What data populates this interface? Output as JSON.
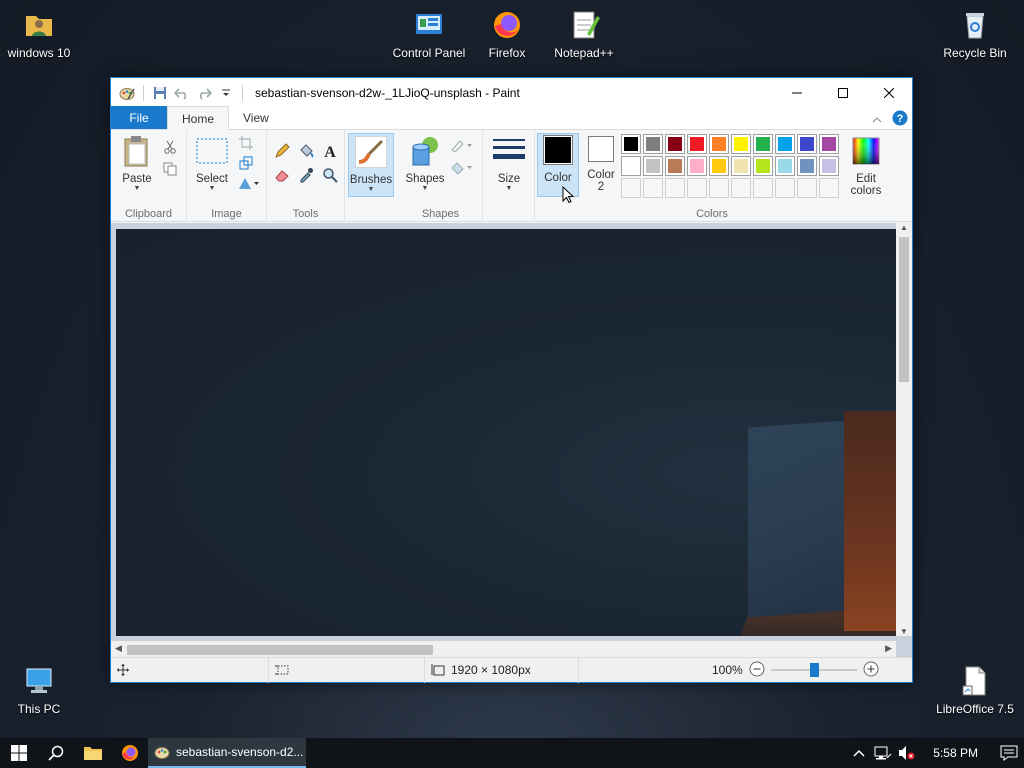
{
  "desktop": {
    "icons": [
      {
        "label": "windows 10"
      },
      {
        "label": "Control Panel"
      },
      {
        "label": "Firefox"
      },
      {
        "label": "Notepad++"
      },
      {
        "label": "Recycle Bin"
      },
      {
        "label": "This PC"
      },
      {
        "label": "LibreOffice 7.5"
      }
    ]
  },
  "window": {
    "title": "sebastian-svenson-d2w-_1LJioQ-unsplash - Paint",
    "accent_color": "#1979ca"
  },
  "tabs": {
    "file": "File",
    "home": "Home",
    "view": "View"
  },
  "ribbon": {
    "clipboard": {
      "paste": "Paste",
      "label": "Clipboard"
    },
    "image": {
      "select": "Select",
      "label": "Image"
    },
    "tools": {
      "label": "Tools"
    },
    "brushes": {
      "label": "Brushes"
    },
    "shapes": {
      "shapes": "Shapes",
      "label": "Shapes"
    },
    "size": {
      "label": "Size"
    },
    "colors": {
      "color1": "Color",
      "color2_line1": "Color",
      "color2_line2": "2",
      "edit_line1": "Edit",
      "edit_line2": "colors",
      "label": "Colors",
      "color1_value": "#000000",
      "color2_value": "#ffffff",
      "palette_row1": [
        "#000000",
        "#7f7f7f",
        "#880015",
        "#ed1c24",
        "#ff7f27",
        "#fff200",
        "#22b14c",
        "#00a2e8",
        "#3f48cc",
        "#a349a4"
      ],
      "palette_row2": [
        "#ffffff",
        "#c3c3c3",
        "#b97a57",
        "#ffaec9",
        "#ffc90e",
        "#efe4b0",
        "#b5e61d",
        "#99d9ea",
        "#7092be",
        "#c8bfe7"
      ]
    }
  },
  "statusbar": {
    "dimensions": "1920 × 1080px",
    "zoom": "100%",
    "zoom_level": 0.5
  },
  "taskbar": {
    "active_app": "sebastian-svenson-d2...",
    "time": "5:58 PM"
  }
}
